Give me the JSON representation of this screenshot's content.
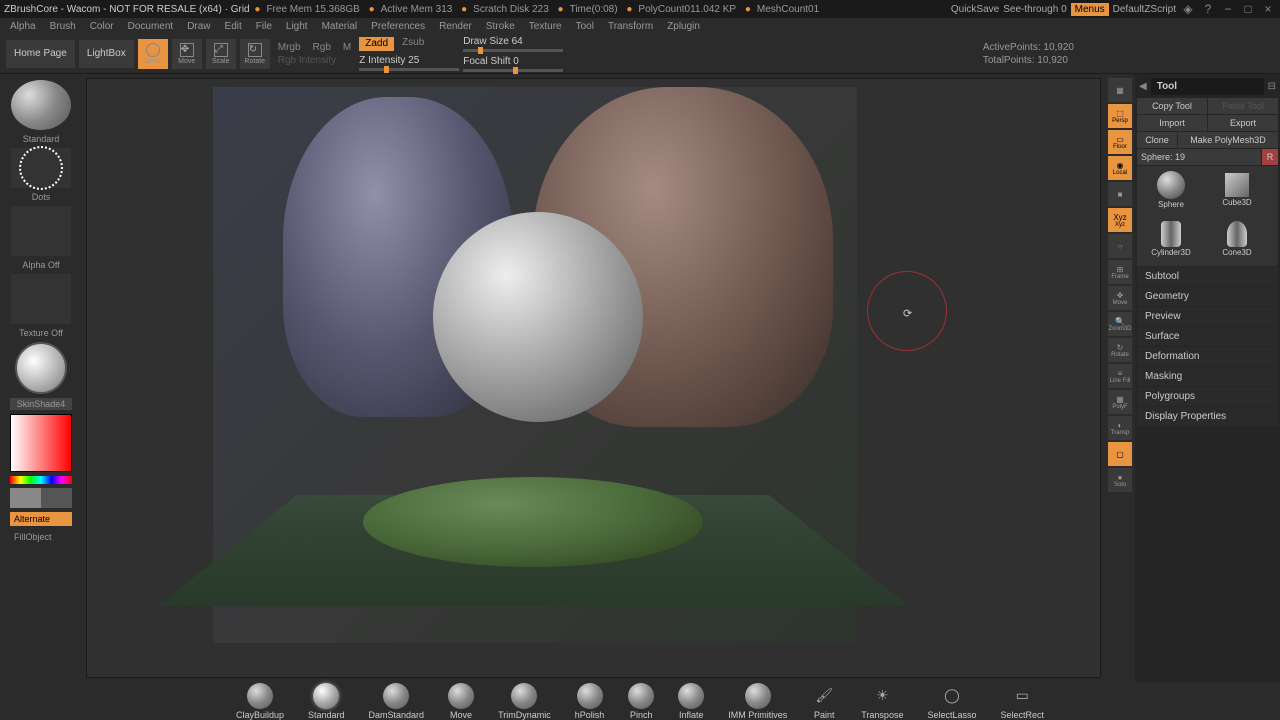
{
  "title": "ZBrushCore - Wacom - NOT FOR RESALE (x64) · Grid",
  "titlestats": [
    "Free Mem 15.368GB",
    "Active Mem 313",
    "Scratch Disk 223",
    "Time(0:08)",
    "PolyCount011.042 KP",
    "MeshCount01"
  ],
  "titleright": {
    "quicksave": "QuickSave",
    "seethrough": "See-through",
    "seethrough_val": "0",
    "menus": "Menus",
    "script": "DefaultZScript"
  },
  "menus": [
    "Alpha",
    "Brush",
    "Color",
    "Document",
    "Draw",
    "Edit",
    "File",
    "Light",
    "Material",
    "Preferences",
    "Render",
    "Stroke",
    "Texture",
    "Tool",
    "Transform",
    "Zplugin"
  ],
  "toolbar": {
    "homepage": "Home Page",
    "lightbox": "LightBox",
    "modes": [
      "Draw",
      "Move",
      "Scale",
      "Rotate"
    ],
    "mrgb": "Mrgb",
    "rgb": "Rgb",
    "m": "M",
    "rgbint": "Rgb Intensity",
    "zadd": "Zadd",
    "zsub": "Zsub",
    "zint": "Z Intensity 25",
    "drawsize": "Draw Size 64",
    "focalshift": "Focal Shift 0",
    "activepoints": "ActivePoints:",
    "activepoints_val": "10,920",
    "totalpoints": "TotalPoints:",
    "totalpoints_val": "10,920"
  },
  "leftpanel": {
    "brush": "Standard",
    "stroke": "Dots",
    "alpha": "Alpha Off",
    "texture": "Texture Off",
    "material": "SkinShade4",
    "alternate": "Alternate",
    "fill": "FillObject"
  },
  "rightbar": [
    "",
    "Persp",
    "Floor",
    "Local",
    "",
    "Xyz",
    "",
    "Frame",
    "Move",
    "Zoom3D",
    "Rotate",
    "Line Fill",
    "PolyF",
    "Transp",
    "",
    "Solo"
  ],
  "rightbar_active": [
    false,
    true,
    true,
    true,
    false,
    true,
    false,
    false,
    false,
    false,
    false,
    false,
    false,
    false,
    true,
    false
  ],
  "toolpanel": {
    "header": "Tool",
    "copytool": "Copy Tool",
    "pastetool": "Paste Tool",
    "import": "Import",
    "export": "Export",
    "clone": "Clone",
    "makepoly": "Make PolyMesh3D",
    "spherelabel": "Sphere: 19",
    "r": "R",
    "tools": [
      "Sphere",
      "Cube3D",
      "Cylinder3D",
      "Cone3D"
    ],
    "sections": [
      "Subtool",
      "Geometry",
      "Preview",
      "Surface",
      "Deformation",
      "Masking",
      "Polygroups",
      "Display Properties"
    ]
  },
  "bottombrushes": [
    "ClayBuildup",
    "Standard",
    "DamStandard",
    "Move",
    "TrimDynamic",
    "hPolish",
    "Pinch",
    "Inflate",
    "IMM Primitives",
    "Paint",
    "Transpose",
    "SelectLasso",
    "SelectRect"
  ],
  "bottombrush_active": 1
}
